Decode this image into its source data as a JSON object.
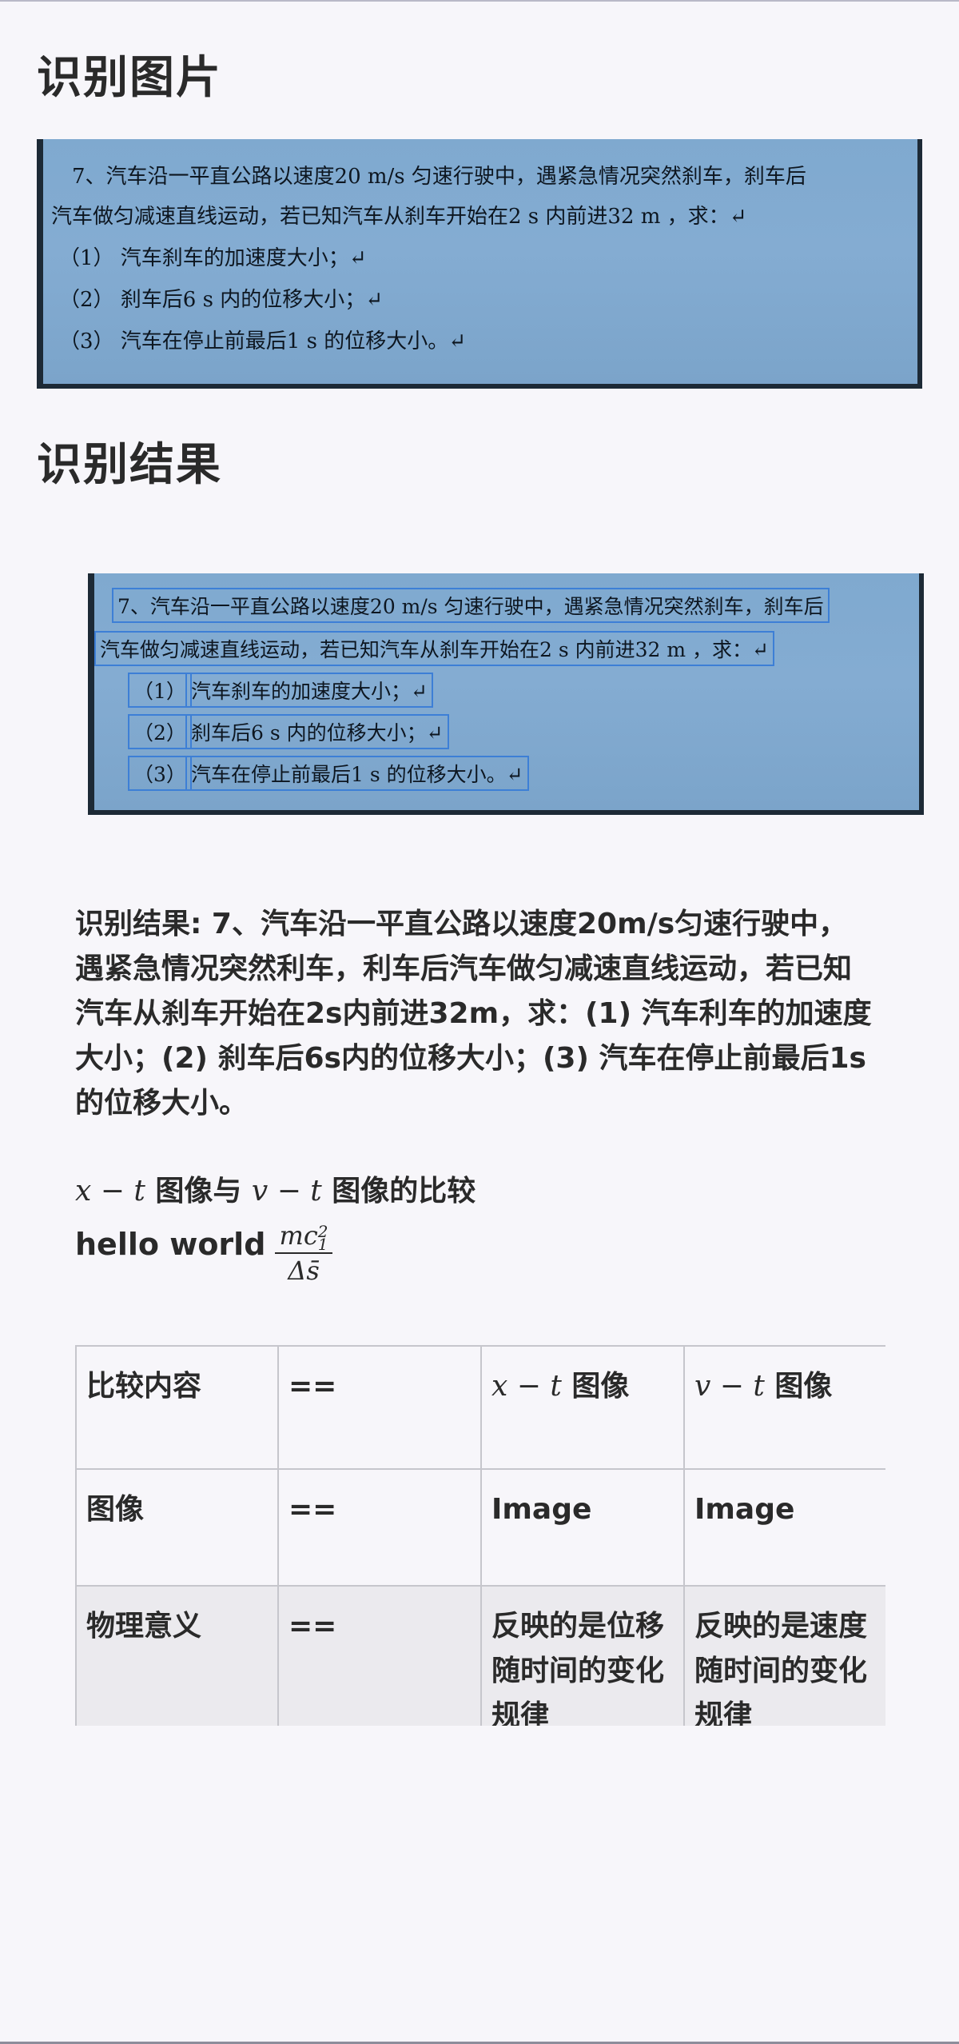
{
  "sections": {
    "image_title": "识别图片",
    "result_title": "识别结果"
  },
  "photo_original": {
    "lines": [
      "7、汽车沿一平直公路以速度20 m/s 匀速行驶中，遇紧急情况突然刹车，刹车后",
      "汽车做匀减速直线运动，若已知汽车从刹车开始在2 s 内前进32 m ，求：↵",
      "（1）  汽车刹车的加速度大小；↵",
      "（2）  刹车后6 s 内的位移大小；↵",
      "（3）  汽车在停止前最后1 s 的位移大小。↵"
    ]
  },
  "photo_annotated": {
    "lines": [
      "7、汽车沿一平直公路以速度20 m/s 匀速行驶中，遇紧急情况突然刹车，刹车后",
      "汽车做匀减速直线运动，若已知汽车从刹车开始在2 s 内前进32 m ，求：↵",
      "（1）",
      "汽车刹车的加速度大小；↵",
      "（2）",
      "刹车后6 s 内的位移大小；↵",
      "（3）",
      "汽车在停止前最后1 s 的位移大小。↵"
    ]
  },
  "result": {
    "text": "识别结果: 7、汽车沿一平直公路以速度20m/s匀速行驶中，遇紧急情况突然利车，利车后汽车做匀减速直线运动，若已知汽车从刹车开始在2s内前进32m，求：(1) 汽车利车的加速度大小；(2) 刹车后6s内的位移大小；(3) 汽车在停止前最后1s的位移大小。"
  },
  "comparison": {
    "math_xt": "x − t",
    "label_1": " 图像与 ",
    "math_vt": "v − t",
    "label_2": " 图像的比较"
  },
  "hello": {
    "text": "hello world",
    "frac_num_base": "mc",
    "frac_num_sup": "2",
    "frac_num_sub": "1",
    "frac_den": "Δs̄"
  },
  "table": {
    "header": {
      "col1": "比较内容",
      "col2": "==",
      "col3_math": "x − t",
      "col3_text": " 图像",
      "col4_math": "v − t",
      "col4_text": " 图像"
    },
    "rows": [
      {
        "c1": "图像",
        "c2": "==",
        "c3": "Image",
        "c4": "Image"
      },
      {
        "c1": "物理意义",
        "c2": "==",
        "c3": "反映的是位移随时间的变化规律",
        "c4": "反映的是速度随时间的变化规律"
      }
    ]
  }
}
